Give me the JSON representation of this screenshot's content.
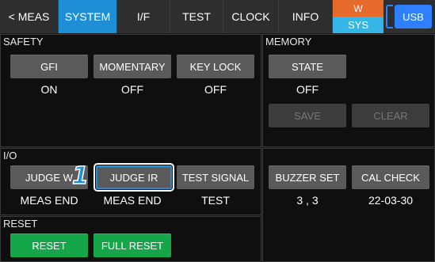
{
  "tabs": [
    {
      "label": "< MEAS"
    },
    {
      "label": "SYSTEM"
    },
    {
      "label": "I/F"
    },
    {
      "label": "TEST"
    },
    {
      "label": "CLOCK"
    },
    {
      "label": "INFO"
    }
  ],
  "status": {
    "w_label": "W",
    "sys_label": "SYS",
    "usb_label": "USB"
  },
  "safety": {
    "title": "SAFETY",
    "gfi": {
      "label": "GFI",
      "value": "ON"
    },
    "momentary": {
      "label": "MOMENTARY",
      "value": "OFF"
    },
    "key_lock": {
      "label": "KEY LOCK",
      "value": "OFF"
    }
  },
  "memory": {
    "title": "MEMORY",
    "state": {
      "label": "STATE",
      "value": "OFF"
    },
    "save_label": "SAVE",
    "clear_label": "CLEAR"
  },
  "io": {
    "title": "I/O",
    "judge_w": {
      "label": "JUDGE W",
      "value": "MEAS END"
    },
    "judge_ir": {
      "label": "JUDGE IR",
      "value": "MEAS END"
    },
    "test_signal": {
      "label": "TEST SIGNAL",
      "value": "TEST"
    }
  },
  "misc": {
    "buzzer_set": {
      "label": "BUZZER SET",
      "value": "3 , 3"
    },
    "cal_check": {
      "label": "CAL CHECK",
      "value": "22-03-30"
    }
  },
  "reset": {
    "title": "RESET",
    "reset_label": "RESET",
    "full_reset_label": "FULL RESET"
  },
  "callout": "1",
  "colors": {
    "accent": "#1e8fd6",
    "green": "#15a64a",
    "w_orange": "#e86a2a",
    "sys_cyan": "#36b6e6",
    "usb_blue": "#2f80ff"
  }
}
